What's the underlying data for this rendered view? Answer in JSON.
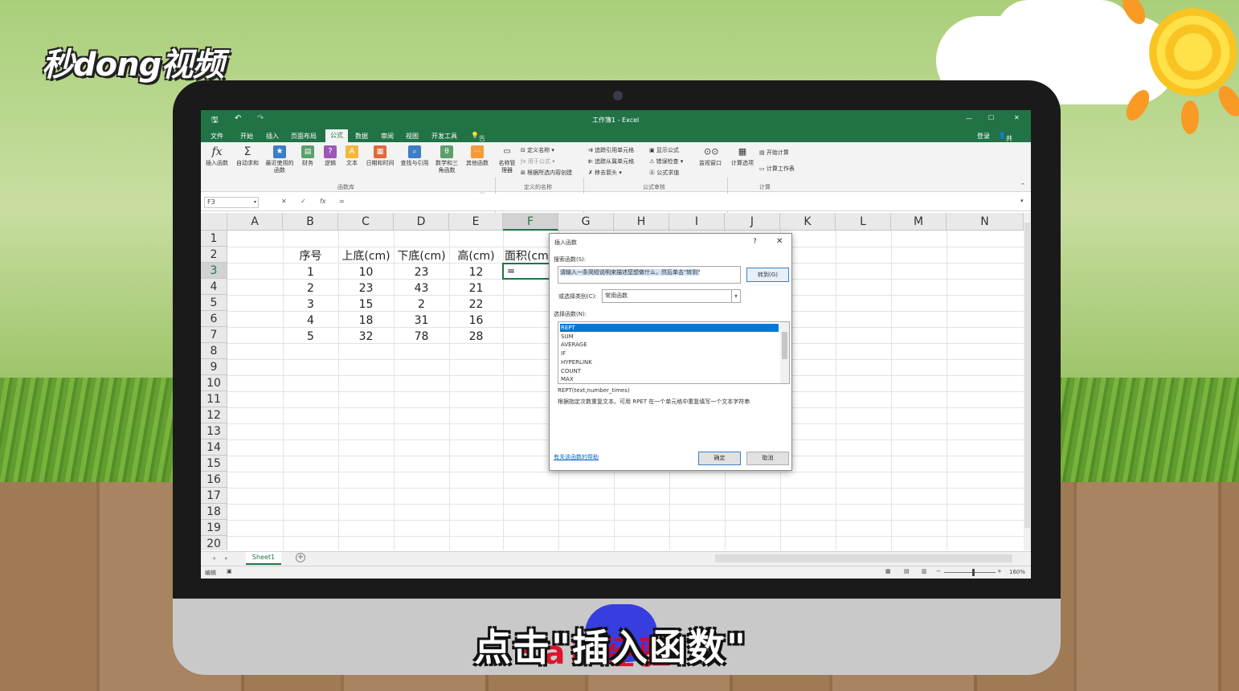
{
  "brand": {
    "logo_text": "秒dong视频"
  },
  "watermark": {
    "text": "Bai 经验"
  },
  "subtitle": "点击\"插入函数\"",
  "excel": {
    "window_title": "工作簿1 - Excel",
    "menu": [
      "文件",
      "开始",
      "插入",
      "页面布局",
      "公式",
      "数据",
      "审阅",
      "视图",
      "开发工具"
    ],
    "active_menu": "公式",
    "tell_me": "告诉我你想要做什么...",
    "sign_in": "登录",
    "share": "共享",
    "ribbon": {
      "insert_function": "插入函数",
      "autosum": "自动求和",
      "recent": "最近使用的函数",
      "financial": "财务",
      "logical": "逻辑",
      "text": "文本",
      "datetime": "日期和时间",
      "lookup": "查找与引用",
      "math": "数学和三角函数",
      "other": "其他函数",
      "group_library": "函数库",
      "name_manager": "名称管理器",
      "define_name": "定义名称",
      "use_in_formula": "用于公式",
      "create_from_selection": "根据所选内容创建",
      "group_names": "定义的名称",
      "trace_precedents": "追踪引用单元格",
      "trace_dependents": "追踪从属单元格",
      "remove_arrows": "移去箭头",
      "show_formulas": "显示公式",
      "error_checking": "错误检查",
      "evaluate_formula": "公式求值",
      "group_audit": "公式审核",
      "watch_window": "监视窗口",
      "calc_options": "计算选项",
      "calc_now": "开始计算",
      "calc_sheet": "计算工作表",
      "group_calc": "计算"
    },
    "namebox": "F3",
    "formula": "=",
    "columns": [
      "A",
      "B",
      "C",
      "D",
      "E",
      "F",
      "G",
      "H",
      "I",
      "J",
      "K",
      "L",
      "M",
      "N"
    ],
    "selected_column": "F",
    "rows": [
      "1",
      "2",
      "3",
      "4",
      "5",
      "6",
      "7",
      "8",
      "9",
      "10",
      "11",
      "12",
      "13",
      "14",
      "15",
      "16",
      "17",
      "18",
      "19",
      "20"
    ],
    "selected_row": "3",
    "table": {
      "headers": [
        "序号",
        "上底(cm)",
        "下底(cm)",
        "高(cm)",
        "面积(cm"
      ],
      "data": [
        [
          "1",
          "10",
          "23",
          "12"
        ],
        [
          "2",
          "23",
          "43",
          "21"
        ],
        [
          "3",
          "15",
          "2",
          "22"
        ],
        [
          "4",
          "18",
          "31",
          "16"
        ],
        [
          "5",
          "32",
          "78",
          "28"
        ]
      ],
      "active_value": "="
    },
    "sheet_tab": "Sheet1",
    "status_mode": "编辑",
    "zoom": "160%"
  },
  "dialog": {
    "title": "插入函数",
    "help_glyph": "?",
    "close_glyph": "✕",
    "search_label": "搜索函数(S):",
    "search_value": "请输入一条简短说明来描述您想做什么，然后单击\"转到\"",
    "goto_label": "转到(G)",
    "category_label": "或选择类别(C):",
    "category_value": "常用函数",
    "select_label": "选择函数(N):",
    "functions": [
      "REPT",
      "SUM",
      "AVERAGE",
      "IF",
      "HYPERLINK",
      "COUNT",
      "MAX"
    ],
    "selected_function": "REPT",
    "signature": "REPT(text,number_times)",
    "description": "根据指定次数重复文本。可用 RPET 在一个单元格中重复填写一个文本字符串",
    "help_link": "有关该函数的帮助",
    "ok_label": "确定",
    "cancel_label": "取消"
  }
}
